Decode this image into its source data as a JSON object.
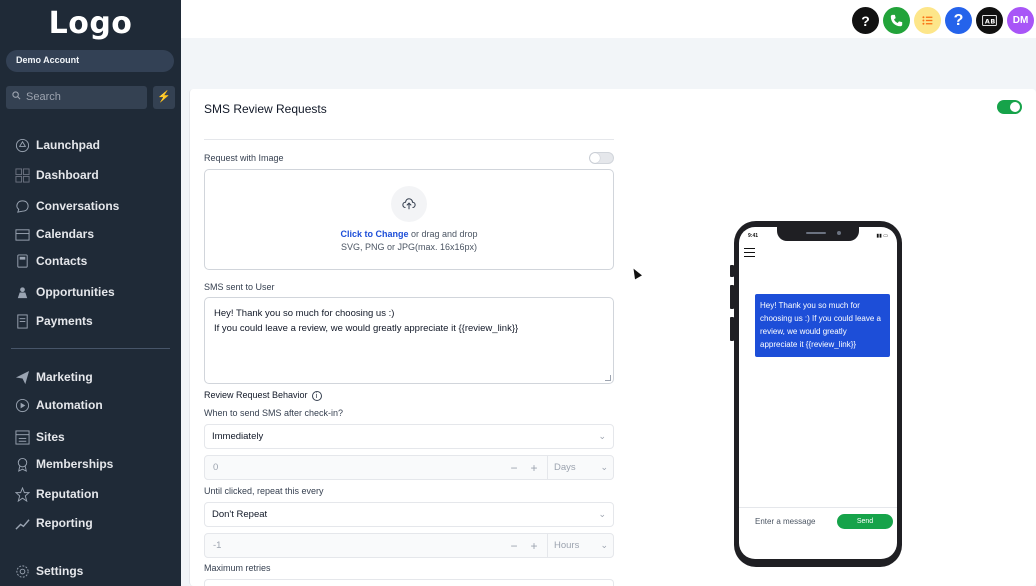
{
  "sidebar": {
    "logo": "Logo",
    "account": "Demo Account",
    "search_placeholder": "Search",
    "items": [
      {
        "label": "Launchpad",
        "icon": "rocket-icon"
      },
      {
        "label": "Dashboard",
        "icon": "grid-icon"
      },
      {
        "label": "Conversations",
        "icon": "chat-icon"
      },
      {
        "label": "Calendars",
        "icon": "calendar-icon"
      },
      {
        "label": "Contacts",
        "icon": "contact-icon"
      },
      {
        "label": "Opportunities",
        "icon": "funnel-icon"
      },
      {
        "label": "Payments",
        "icon": "receipt-icon"
      },
      {
        "label": "Marketing",
        "icon": "send-icon"
      },
      {
        "label": "Automation",
        "icon": "play-icon"
      },
      {
        "label": "Sites",
        "icon": "site-icon"
      },
      {
        "label": "Memberships",
        "icon": "badge-icon"
      },
      {
        "label": "Reputation",
        "icon": "star-icon"
      },
      {
        "label": "Reporting",
        "icon": "chart-icon"
      },
      {
        "label": "Settings",
        "icon": "gear-icon"
      }
    ]
  },
  "topbar": {
    "icons": [
      {
        "name": "help-icon",
        "glyph": "?",
        "bg": "#111111"
      },
      {
        "name": "phone-icon",
        "glyph": "✆",
        "bg": "#22a33a"
      },
      {
        "name": "list-icon",
        "glyph": "☰",
        "bg": "#fde68a"
      },
      {
        "name": "help-blue-icon",
        "glyph": "?",
        "bg": "#2563eb"
      },
      {
        "name": "translate-icon",
        "glyph": "ab",
        "bg": "#111111"
      },
      {
        "name": "avatar",
        "glyph": "DM",
        "bg": "#a855f7"
      }
    ]
  },
  "card": {
    "title": "SMS Review Requests",
    "request_with_image_label": "Request with Image",
    "upload": {
      "link": "Click to Change",
      "text": "or drag and drop",
      "formats": "SVG, PNG or JPG(max. 16x16px)"
    },
    "sms_label": "SMS sent to User",
    "sms_line1": "Hey! Thank you so much for choosing us :)",
    "sms_line2": "If you could leave a review, we would greatly appreciate it {{review_link}}",
    "behavior_label": "Review Request Behavior",
    "when_label": "When to send SMS after check-in?",
    "when_value": "Immediately",
    "delay_value": "0",
    "delay_unit": "Days",
    "repeat_label": "Until clicked, repeat this every",
    "repeat_value": "Don't Repeat",
    "repeat_num": "-1",
    "repeat_unit": "Hours",
    "retries_label": "Maximum retries"
  },
  "phone": {
    "time": "9:41",
    "message": "Hey! Thank you so much for choosing us :) If you could leave a review, we would greatly appreciate it {{review_link}}",
    "input_placeholder": "Enter a message",
    "send_label": "Send"
  }
}
